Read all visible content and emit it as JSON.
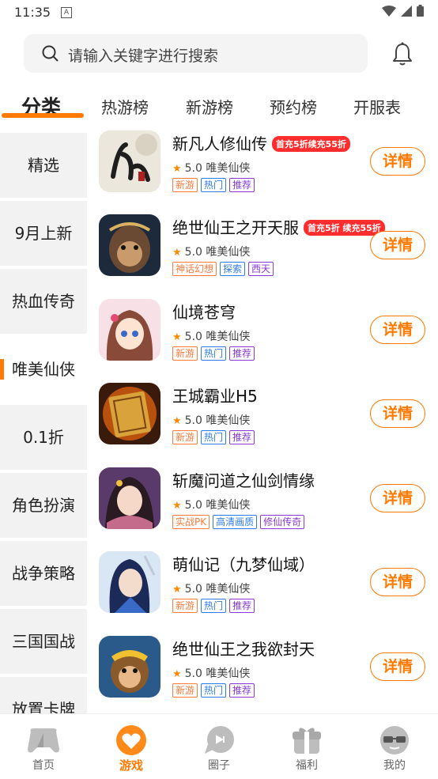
{
  "status_bar": {
    "time": "11:35",
    "notif_icon": "A"
  },
  "search": {
    "placeholder": "请输入关键字进行搜索"
  },
  "tabs": [
    "分类",
    "热游榜",
    "新游榜",
    "预约榜",
    "开服表"
  ],
  "sidebar": {
    "items": [
      "精选",
      "9月上新",
      "热血传奇",
      "唯美仙侠",
      "0.1折",
      "角色扮演",
      "战争策略",
      "三国国战",
      "放置卡牌"
    ],
    "active_index": 3
  },
  "games": [
    {
      "name": "新凡人修仙传",
      "promo": "首充5折续充55折",
      "rating": "5.0",
      "category": "唯美仙侠",
      "tags": [
        "新游",
        "热门",
        "推荐"
      ],
      "button": "详情",
      "icon": "calligraphy-icon"
    },
    {
      "name": "绝世仙王之开天服",
      "promo": "首充5折 续充55折",
      "rating": "5.0",
      "category": "唯美仙侠",
      "tags": [
        "神话幻想",
        "探索",
        "西天"
      ],
      "button": "详情",
      "icon": "monkey-king-icon"
    },
    {
      "name": "仙境苍穹",
      "promo": "",
      "rating": "5.0",
      "category": "唯美仙侠",
      "tags": [
        "新游",
        "热门",
        "推荐"
      ],
      "button": "详情",
      "icon": "anime-girl-icon"
    },
    {
      "name": "王城霸业H5",
      "promo": "",
      "rating": "5.0",
      "category": "唯美仙侠",
      "tags": [
        "新游",
        "热门",
        "推荐"
      ],
      "button": "详情",
      "icon": "golden-book-icon"
    },
    {
      "name": "斩魔问道之仙剑情缘",
      "promo": "",
      "rating": "5.0",
      "category": "唯美仙侠",
      "tags": [
        "实战PK",
        "高清画质",
        "修仙传奇"
      ],
      "button": "详情",
      "icon": "fairy-girl-icon"
    },
    {
      "name": "萌仙记（九梦仙域）",
      "promo": "",
      "rating": "5.0",
      "category": "唯美仙侠",
      "tags": [
        "新游",
        "热门",
        "推荐"
      ],
      "button": "详情",
      "icon": "swordsman-icon"
    },
    {
      "name": "绝世仙王之我欲封天",
      "promo": "",
      "rating": "5.0",
      "category": "唯美仙侠",
      "tags": [
        "新游",
        "热门",
        "推荐"
      ],
      "button": "详情",
      "icon": "monkey-crown-icon"
    }
  ],
  "bottom_nav": [
    {
      "label": "首页",
      "icon": "gamepad-icon"
    },
    {
      "label": "游戏",
      "icon": "game-heart-icon",
      "active": true
    },
    {
      "label": "圈子",
      "icon": "chat-bubble-icon"
    },
    {
      "label": "福利",
      "icon": "gift-icon"
    },
    {
      "label": "我的",
      "icon": "glasses-face-icon"
    }
  ],
  "colors": {
    "accent": "#ff7a00",
    "promo_red": "#ff2d2d",
    "tag_orange": "#ff7a3d",
    "tag_blue": "#2f7ce6",
    "tag_purple": "#8a3ad6",
    "star": "#ff8a00"
  }
}
